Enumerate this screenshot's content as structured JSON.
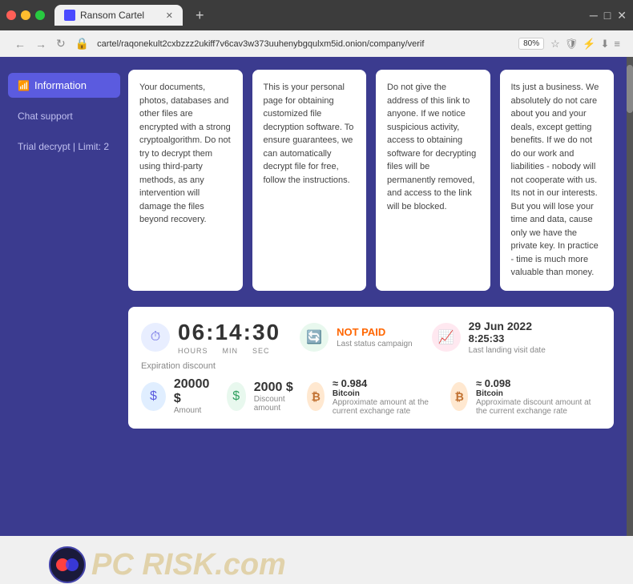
{
  "browser": {
    "title": "Ransom Cartel",
    "url": "cartel/raqonekult2cxbzzz2ukiff7v6cav3w373uuhenybgqulxm5id.onion/company/verif",
    "zoom": "80%",
    "new_tab_label": "+"
  },
  "sidebar": {
    "items": [
      {
        "id": "information",
        "label": "Information",
        "active": true,
        "icon": "📶"
      },
      {
        "id": "chat",
        "label": "Chat support",
        "active": false
      },
      {
        "id": "trial",
        "label": "Trial decrypt | Limit: 2",
        "active": false
      }
    ]
  },
  "cards": [
    {
      "id": "card1",
      "text": "Your documents, photos, databases and other files are encrypted with a strong cryptoalgorithm. Do not try to decrypt them using third-party methods, as any intervention will damage the files beyond recovery."
    },
    {
      "id": "card2",
      "text": "This is your personal page for obtaining customized file decryption software. To ensure guarantees, we can automatically decrypt file for free, follow the instructions."
    },
    {
      "id": "card3",
      "text": "Do not give the address of this link to anyone. If we notice suspicious activity, access to obtaining software for decrypting files will be permanently removed, and access to the link will be blocked."
    },
    {
      "id": "card4",
      "text": "Its just a business. We absolutely do not care about you and your deals, except getting benefits. If we do not do our work and liabilities - nobody will not cooperate with us. Its not in our interests. But you will lose your time and data, cause only we have the private key. In practice - time is much more valuable than money."
    }
  ],
  "stats": {
    "timer": {
      "value": "06:14:30",
      "hours_label": "HOURS",
      "min_label": "MIN",
      "sec_label": "SEC"
    },
    "status": {
      "value": "NOT PAID",
      "sub": "Last status campaign"
    },
    "visit_date": {
      "value": "29 Jun 2022",
      "time": "8:25:33",
      "label": "Last landing visit date"
    },
    "expiration_label": "Expiration discount"
  },
  "amounts": {
    "main_amount": "20000 $",
    "main_label": "Amount",
    "discount_amount": "2000 $",
    "discount_label": "Discount amount",
    "btc_approx": "≈ 0.984",
    "btc_approx_label": "Bitcoin",
    "btc_approx_sub": "Approximate amount at the current exchange rate",
    "btc_discount": "≈ 0.098",
    "btc_discount_label": "Bitcoin",
    "btc_discount_sub": "Approximate discount amount at the current exchange rate"
  },
  "watermark": {
    "text": "PC RISK.com"
  }
}
